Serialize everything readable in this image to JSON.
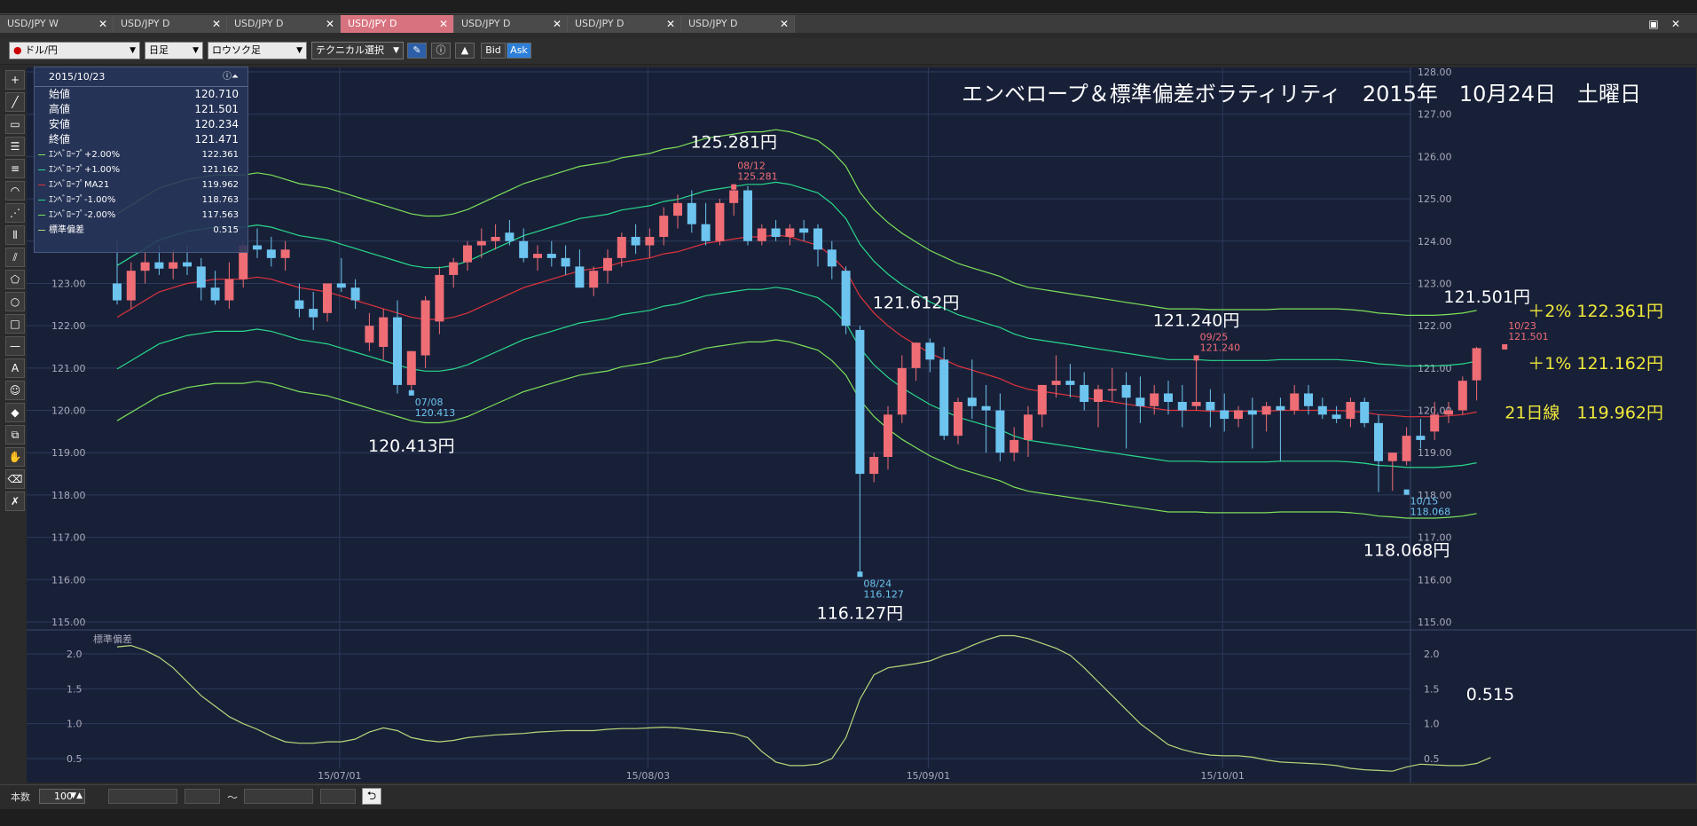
{
  "tabs": [
    {
      "label": "USD/JPY W",
      "active": false
    },
    {
      "label": "USD/JPY D",
      "active": false
    },
    {
      "label": "USD/JPY D",
      "active": false
    },
    {
      "label": "USD/JPY D",
      "active": true
    },
    {
      "label": "USD/JPY D",
      "active": false
    },
    {
      "label": "USD/JPY D",
      "active": false
    },
    {
      "label": "USD/JPY D",
      "active": false
    }
  ],
  "toolbar": {
    "pair": "ドル/円",
    "period": "日足",
    "style": "ロウソク足",
    "technical": "テクニカル選択",
    "bid": "Bid",
    "ask": "Ask"
  },
  "info": {
    "date": "2015/10/23",
    "rows": [
      {
        "k": "始値",
        "v": "120.710"
      },
      {
        "k": "高値",
        "v": "121.501"
      },
      {
        "k": "安値",
        "v": "120.234"
      },
      {
        "k": "終値",
        "v": "121.471"
      }
    ],
    "indicators": [
      {
        "k": "ｴﾝﾍﾞﾛｰﾌﾟ+2.00%",
        "v": "122.361",
        "color": "#7de05a"
      },
      {
        "k": "ｴﾝﾍﾞﾛｰﾌﾟ+1.00%",
        "v": "121.162",
        "color": "#29d98c"
      },
      {
        "k": "ｴﾝﾍﾞﾛｰﾌﾟMA21",
        "v": "119.962",
        "color": "#e0333c"
      },
      {
        "k": "ｴﾝﾍﾞﾛｰﾌﾟ-1.00%",
        "v": "118.763",
        "color": "#29d98c"
      },
      {
        "k": "ｴﾝﾍﾞﾛｰﾌﾟ-2.00%",
        "v": "117.563",
        "color": "#7de05a"
      },
      {
        "k": "標準偏差",
        "v": "0.515",
        "color": "#b9d77a"
      }
    ]
  },
  "chart_data": {
    "type": "line",
    "title": "エンベロープ＆標準偏差ボラティリティ　2015年　10月24日　土曜日",
    "price_axis": [
      128.0,
      127.0,
      126.0,
      125.0,
      124.0,
      123.0,
      122.0,
      121.0,
      120.0,
      119.0,
      118.0,
      117.0,
      116.0,
      115.0
    ],
    "price_axis_labels": [
      "128.00",
      "127.00",
      "126.00",
      "125.00",
      "124.00",
      "123.00",
      "122.00",
      "121.00",
      "120.00",
      "119.00",
      "118.00",
      "117.00",
      "116.00",
      "115.00"
    ],
    "ylim": [
      115.0,
      128.0
    ],
    "sub_axis_labels": [
      "2.0",
      "1.5",
      "1.0",
      "0.5"
    ],
    "sub_ylim": [
      0.25,
      2.3
    ],
    "sub_label": "標準偏差",
    "date_labels": [
      "15/07/01",
      "15/08/03",
      "15/09/01",
      "15/10/01"
    ],
    "date_index": [
      16,
      38,
      58,
      79
    ],
    "candles": [
      [
        123.0,
        124.0,
        122.5,
        122.6
      ],
      [
        122.6,
        123.5,
        122.4,
        123.3
      ],
      [
        123.3,
        123.8,
        123.0,
        123.5
      ],
      [
        123.5,
        123.9,
        123.2,
        123.35
      ],
      [
        123.35,
        123.8,
        123.1,
        123.5
      ],
      [
        123.5,
        123.9,
        123.2,
        123.4
      ],
      [
        123.4,
        123.6,
        122.6,
        122.9
      ],
      [
        122.9,
        123.3,
        122.5,
        122.6
      ],
      [
        122.6,
        123.5,
        122.4,
        123.1
      ],
      [
        123.1,
        124.0,
        122.9,
        123.9
      ],
      [
        123.9,
        124.3,
        123.6,
        123.8
      ],
      [
        123.8,
        124.1,
        123.4,
        123.6
      ],
      [
        123.6,
        124.0,
        123.3,
        123.8
      ],
      [
        122.6,
        123.0,
        122.2,
        122.4
      ],
      [
        122.4,
        122.8,
        121.9,
        122.2
      ],
      [
        122.3,
        123.0,
        122.1,
        123.0
      ],
      [
        123.0,
        123.6,
        122.8,
        122.9
      ],
      [
        122.9,
        123.1,
        122.4,
        122.6
      ],
      [
        121.6,
        122.3,
        121.4,
        122.0
      ],
      [
        121.5,
        122.4,
        121.2,
        122.2
      ],
      [
        122.2,
        122.6,
        120.4,
        120.6
      ],
      [
        120.6,
        121.4,
        120.413,
        121.4
      ],
      [
        121.3,
        122.7,
        121.0,
        122.6
      ],
      [
        122.1,
        123.4,
        121.8,
        123.2
      ],
      [
        123.2,
        123.6,
        122.9,
        123.5
      ],
      [
        123.5,
        124.0,
        123.3,
        123.9
      ],
      [
        123.9,
        124.3,
        123.6,
        124.0
      ],
      [
        124.0,
        124.4,
        123.8,
        124.1
      ],
      [
        124.2,
        124.5,
        123.9,
        124.0
      ],
      [
        124.0,
        124.3,
        123.5,
        123.6
      ],
      [
        123.6,
        123.9,
        123.3,
        123.7
      ],
      [
        123.7,
        124.0,
        123.4,
        123.6
      ],
      [
        123.6,
        123.9,
        123.2,
        123.4
      ],
      [
        123.4,
        123.8,
        123.0,
        122.9
      ],
      [
        122.9,
        123.4,
        122.7,
        123.3
      ],
      [
        123.3,
        123.8,
        123.0,
        123.6
      ],
      [
        123.6,
        124.2,
        123.4,
        124.1
      ],
      [
        124.1,
        124.4,
        123.7,
        123.9
      ],
      [
        123.9,
        124.3,
        123.6,
        124.1
      ],
      [
        124.1,
        124.8,
        123.9,
        124.6
      ],
      [
        124.6,
        125.1,
        124.3,
        124.9
      ],
      [
        124.9,
        125.2,
        124.2,
        124.4
      ],
      [
        124.4,
        124.9,
        123.9,
        124.0
      ],
      [
        124.0,
        125.0,
        123.9,
        124.9
      ],
      [
        124.9,
        125.281,
        124.6,
        125.2
      ],
      [
        125.2,
        125.3,
        123.9,
        124.0
      ],
      [
        124.0,
        124.4,
        123.9,
        124.3
      ],
      [
        124.3,
        124.5,
        124.0,
        124.1
      ],
      [
        124.1,
        124.4,
        123.9,
        124.3
      ],
      [
        124.3,
        124.5,
        124.0,
        124.2
      ],
      [
        124.3,
        124.4,
        123.4,
        123.8
      ],
      [
        123.8,
        124.0,
        123.1,
        123.4
      ],
      [
        123.3,
        123.4,
        121.8,
        122.0
      ],
      [
        121.9,
        122.0,
        116.127,
        118.5
      ],
      [
        118.5,
        119.0,
        118.3,
        118.9
      ],
      [
        118.9,
        120.1,
        118.6,
        119.9
      ],
      [
        119.9,
        121.3,
        119.7,
        121.0
      ],
      [
        121.0,
        121.6,
        120.7,
        121.6
      ],
      [
        121.6,
        121.7,
        120.9,
        121.2
      ],
      [
        121.2,
        121.5,
        119.3,
        119.4
      ],
      [
        119.4,
        120.3,
        119.2,
        120.2
      ],
      [
        120.3,
        121.2,
        119.8,
        120.1
      ],
      [
        120.1,
        120.6,
        119.0,
        120.0
      ],
      [
        120.0,
        120.4,
        118.8,
        119.0
      ],
      [
        119.0,
        119.6,
        118.8,
        119.3
      ],
      [
        119.3,
        120.1,
        118.9,
        119.9
      ],
      [
        119.9,
        120.6,
        119.6,
        120.6
      ],
      [
        120.6,
        121.3,
        120.3,
        120.7
      ],
      [
        120.7,
        121.1,
        120.3,
        120.6
      ],
      [
        120.6,
        120.9,
        120.0,
        120.2
      ],
      [
        120.2,
        120.6,
        119.6,
        120.5
      ],
      [
        120.5,
        121.0,
        120.2,
        120.5
      ],
      [
        120.6,
        120.9,
        119.1,
        120.3
      ],
      [
        120.3,
        120.8,
        119.7,
        120.1
      ],
      [
        120.1,
        120.6,
        119.9,
        120.4
      ],
      [
        120.4,
        120.7,
        119.9,
        120.2
      ],
      [
        120.2,
        120.6,
        119.6,
        120.0
      ],
      [
        120.1,
        121.24,
        120.0,
        120.2
      ],
      [
        120.2,
        120.5,
        119.6,
        120.0
      ],
      [
        120.0,
        120.4,
        119.5,
        119.8
      ],
      [
        119.8,
        120.1,
        119.6,
        120.0
      ],
      [
        120.0,
        120.3,
        119.1,
        119.9
      ],
      [
        119.9,
        120.2,
        119.5,
        120.1
      ],
      [
        120.1,
        120.3,
        118.8,
        120.0
      ],
      [
        120.0,
        120.6,
        119.9,
        120.4
      ],
      [
        120.4,
        120.6,
        119.9,
        120.1
      ],
      [
        120.1,
        120.3,
        119.8,
        119.9
      ],
      [
        119.9,
        120.1,
        119.7,
        119.8
      ],
      [
        119.8,
        120.3,
        119.6,
        120.2
      ],
      [
        120.2,
        120.3,
        119.6,
        119.7
      ],
      [
        119.7,
        119.9,
        118.068,
        118.8
      ],
      [
        118.8,
        119.0,
        118.1,
        119.0
      ],
      [
        118.8,
        119.6,
        118.7,
        119.4
      ],
      [
        119.4,
        119.8,
        119.1,
        119.3
      ],
      [
        119.5,
        120.2,
        119.3,
        119.9
      ],
      [
        119.9,
        120.2,
        119.7,
        120.0
      ],
      [
        120.0,
        120.8,
        119.9,
        120.7
      ],
      [
        120.71,
        121.501,
        120.234,
        121.471
      ]
    ],
    "ma21": [
      122.2,
      122.4,
      122.6,
      122.8,
      122.9,
      123.0,
      123.05,
      123.1,
      123.1,
      123.1,
      123.15,
      123.1,
      123.0,
      122.9,
      122.85,
      122.8,
      122.7,
      122.6,
      122.5,
      122.4,
      122.3,
      122.2,
      122.15,
      122.15,
      122.2,
      122.3,
      122.45,
      122.6,
      122.75,
      122.9,
      123.0,
      123.1,
      123.2,
      123.3,
      123.35,
      123.4,
      123.5,
      123.55,
      123.6,
      123.7,
      123.75,
      123.85,
      123.95,
      124.0,
      124.05,
      124.1,
      124.1,
      124.15,
      124.1,
      124.0,
      123.9,
      123.65,
      123.3,
      122.7,
      122.3,
      122.0,
      121.75,
      121.55,
      121.35,
      121.2,
      121.05,
      120.95,
      120.85,
      120.75,
      120.6,
      120.5,
      120.45,
      120.4,
      120.35,
      120.3,
      120.25,
      120.2,
      120.15,
      120.1,
      120.05,
      120.0,
      120.0,
      120.0,
      119.98,
      119.98,
      119.98,
      119.98,
      119.98,
      120.0,
      120.0,
      120.0,
      120.0,
      120.0,
      119.98,
      119.95,
      119.9,
      119.88,
      119.85,
      119.85,
      119.85,
      119.87,
      119.9,
      119.962
    ],
    "std": [
      2.1,
      2.12,
      2.05,
      1.95,
      1.8,
      1.6,
      1.4,
      1.25,
      1.1,
      1.0,
      0.92,
      0.82,
      0.74,
      0.72,
      0.72,
      0.74,
      0.74,
      0.78,
      0.88,
      0.94,
      0.9,
      0.8,
      0.76,
      0.74,
      0.76,
      0.8,
      0.82,
      0.84,
      0.85,
      0.86,
      0.88,
      0.89,
      0.9,
      0.9,
      0.9,
      0.92,
      0.93,
      0.93,
      0.94,
      0.95,
      0.94,
      0.92,
      0.9,
      0.88,
      0.86,
      0.8,
      0.6,
      0.45,
      0.4,
      0.4,
      0.42,
      0.5,
      0.8,
      1.35,
      1.7,
      1.8,
      1.83,
      1.86,
      1.9,
      1.98,
      2.03,
      2.12,
      2.2,
      2.26,
      2.26,
      2.22,
      2.15,
      2.08,
      1.98,
      1.8,
      1.6,
      1.4,
      1.2,
      1.0,
      0.85,
      0.7,
      0.63,
      0.58,
      0.55,
      0.54,
      0.54,
      0.52,
      0.48,
      0.45,
      0.44,
      0.43,
      0.42,
      0.4,
      0.36,
      0.34,
      0.33,
      0.32,
      0.38,
      0.42,
      0.41,
      0.4,
      0.4,
      0.43,
      0.515
    ],
    "annotations": [
      {
        "text": "125.281円",
        "idx": 44,
        "price": 125.281,
        "pos": "above-big"
      },
      {
        "text": "120.413円",
        "idx": 21,
        "price": 120.413,
        "pos": "below-big"
      },
      {
        "text": "116.127円",
        "idx": 53,
        "price": 116.127,
        "pos": "below-big"
      },
      {
        "text": "121.612円",
        "idx": 57,
        "price": 121.612,
        "pos": "above-big"
      },
      {
        "text": "121.240円",
        "idx": 77,
        "price": 121.24,
        "pos": "above-big"
      },
      {
        "text": "118.068円",
        "idx": 92,
        "price": 118.068,
        "pos": "below-big"
      },
      {
        "text": "121.501円",
        "idx": 99,
        "price": 121.501,
        "pos": "above-big"
      }
    ],
    "small_labels": [
      {
        "date": "08/12",
        "price": "125.281",
        "idx": 44,
        "color": "#ef6d75",
        "pos": "above"
      },
      {
        "date": "07/08",
        "price": "120.413",
        "idx": 21,
        "color": "#6cc4ef",
        "pos": "below"
      },
      {
        "date": "08/24",
        "price": "116.127",
        "idx": 53,
        "color": "#6cc4ef",
        "pos": "below"
      },
      {
        "date": "09/25",
        "price": "121.240",
        "idx": 77,
        "color": "#ef6d75",
        "pos": "above"
      },
      {
        "date": "10/15",
        "price": "118.068",
        "idx": 92,
        "color": "#6cc4ef",
        "pos": "below"
      },
      {
        "date": "10/23",
        "price": "121.501",
        "idx": 99,
        "color": "#ef6d75",
        "pos": "above"
      }
    ],
    "right_notes": [
      {
        "text": "＋2% 122.361円",
        "price": 122.361,
        "color": "#f0e83a"
      },
      {
        "text": "＋1% 121.162円",
        "price": 121.162,
        "color": "#f0e83a"
      },
      {
        "text": "21日線　119.962円",
        "price": 119.962,
        "color": "#f0e83a"
      }
    ],
    "std_note": "0.515"
  },
  "bottom": {
    "count_label": "本数",
    "count_value": "100",
    "tilde": "～"
  }
}
